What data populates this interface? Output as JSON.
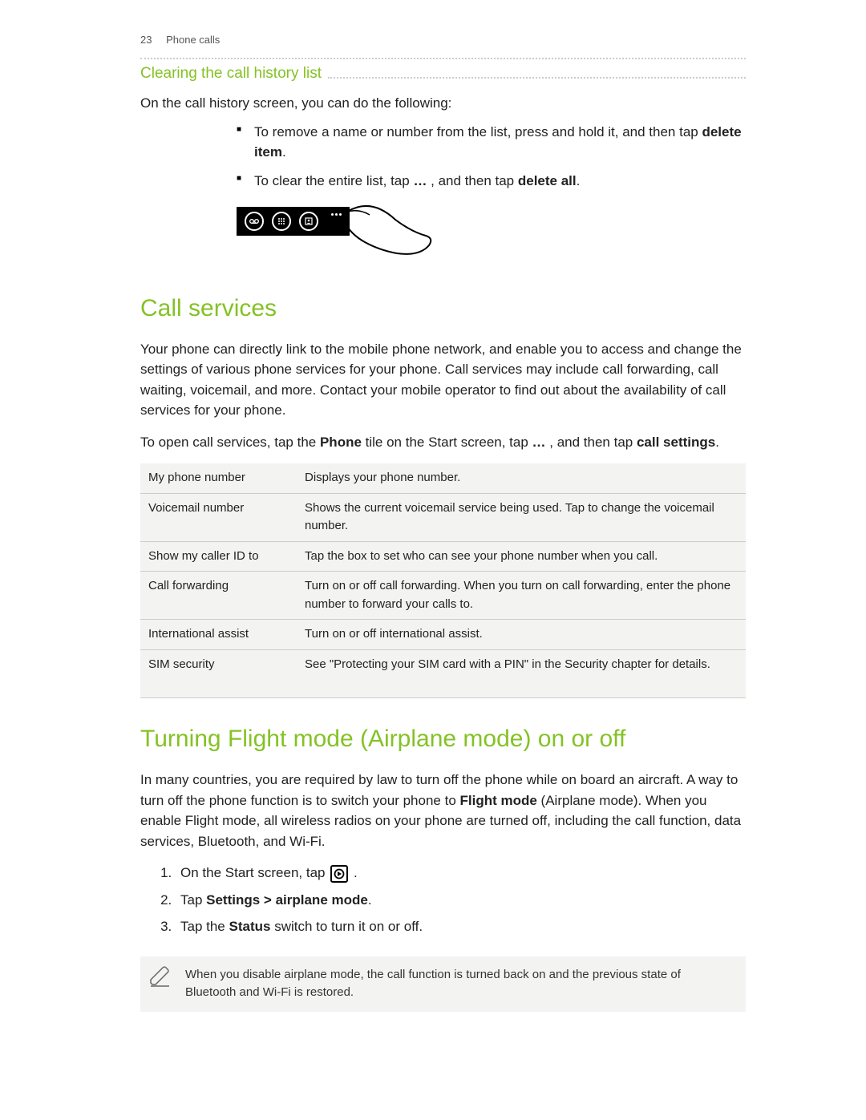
{
  "header": {
    "page_num": "23",
    "section": "Phone calls"
  },
  "sub1": {
    "title": "Clearing the call history list",
    "intro": "On the call history screen, you can do the following:",
    "bullet1a": "To remove a name or number from the list, press and hold it, and then tap ",
    "bullet1b": "delete item",
    "bullet1c": ".",
    "bullet2a": "To clear the entire list, tap ",
    "bullet2b": "…",
    "bullet2c": " , and then tap ",
    "bullet2d": "delete all",
    "bullet2e": "."
  },
  "sec_call": {
    "title": "Call services",
    "p1": "Your phone can directly link to the mobile phone network, and enable you to access and change the settings of various phone services for your phone. Call services may include call forwarding, call waiting, voicemail, and more. Contact your mobile operator to find out about the availability of call services for your phone.",
    "p2a": "To open call services, tap the ",
    "p2b": "Phone",
    "p2c": " tile on the Start screen, tap ",
    "p2d": "…",
    "p2e": " , and then tap ",
    "p2f": "call settings",
    "p2g": ".",
    "rows": [
      {
        "label": "My phone number",
        "desc": "Displays your phone number."
      },
      {
        "label": "Voicemail number",
        "desc": "Shows the current voicemail service being used. Tap to change the voicemail number."
      },
      {
        "label": "Show my caller ID to",
        "desc": "Tap the box to set who can see your phone number when you call."
      },
      {
        "label": "Call forwarding",
        "desc": "Turn on or off call forwarding. When you turn on call forwarding, enter the phone number to forward your calls to."
      },
      {
        "label": "International assist",
        "desc": "Turn on or off international assist."
      },
      {
        "label": "SIM security",
        "desc": "See \"Protecting your SIM card with a PIN\" in the Security chapter for details."
      }
    ]
  },
  "sec_flight": {
    "title": "Turning Flight mode (Airplane mode) on or off",
    "p1a": "In many countries, you are required by law to turn off the phone while on board an aircraft. A way to turn off the phone function is to switch your phone to ",
    "p1b": "Flight mode",
    "p1c": " (Airplane mode). When you enable Flight mode, all wireless radios on your phone are turned off, including the call function, data services, Bluetooth, and Wi-Fi.",
    "step1a": "On the Start screen, tap ",
    "step1b": " .",
    "step2a": "Tap ",
    "step2b": "Settings > airplane mode",
    "step2c": ".",
    "step3a": "Tap the ",
    "step3b": "Status",
    "step3c": " switch to turn it on or off.",
    "note": "When you disable airplane mode, the call function is turned back on and the previous state of Bluetooth and Wi-Fi is restored."
  }
}
